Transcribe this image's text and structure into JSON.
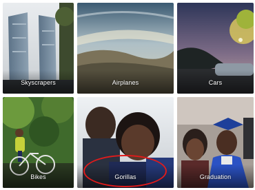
{
  "albums": [
    {
      "id": "skyscrapers",
      "label": "Skyscrapers"
    },
    {
      "id": "airplanes",
      "label": "Airplanes"
    },
    {
      "id": "cars",
      "label": "Cars"
    },
    {
      "id": "bikes",
      "label": "Bikes"
    },
    {
      "id": "gorillas",
      "label": "Gorillas"
    },
    {
      "id": "graduation",
      "label": "Graduation"
    }
  ],
  "highlight": {
    "album": "Gorillas",
    "color": "#e01b1b"
  }
}
